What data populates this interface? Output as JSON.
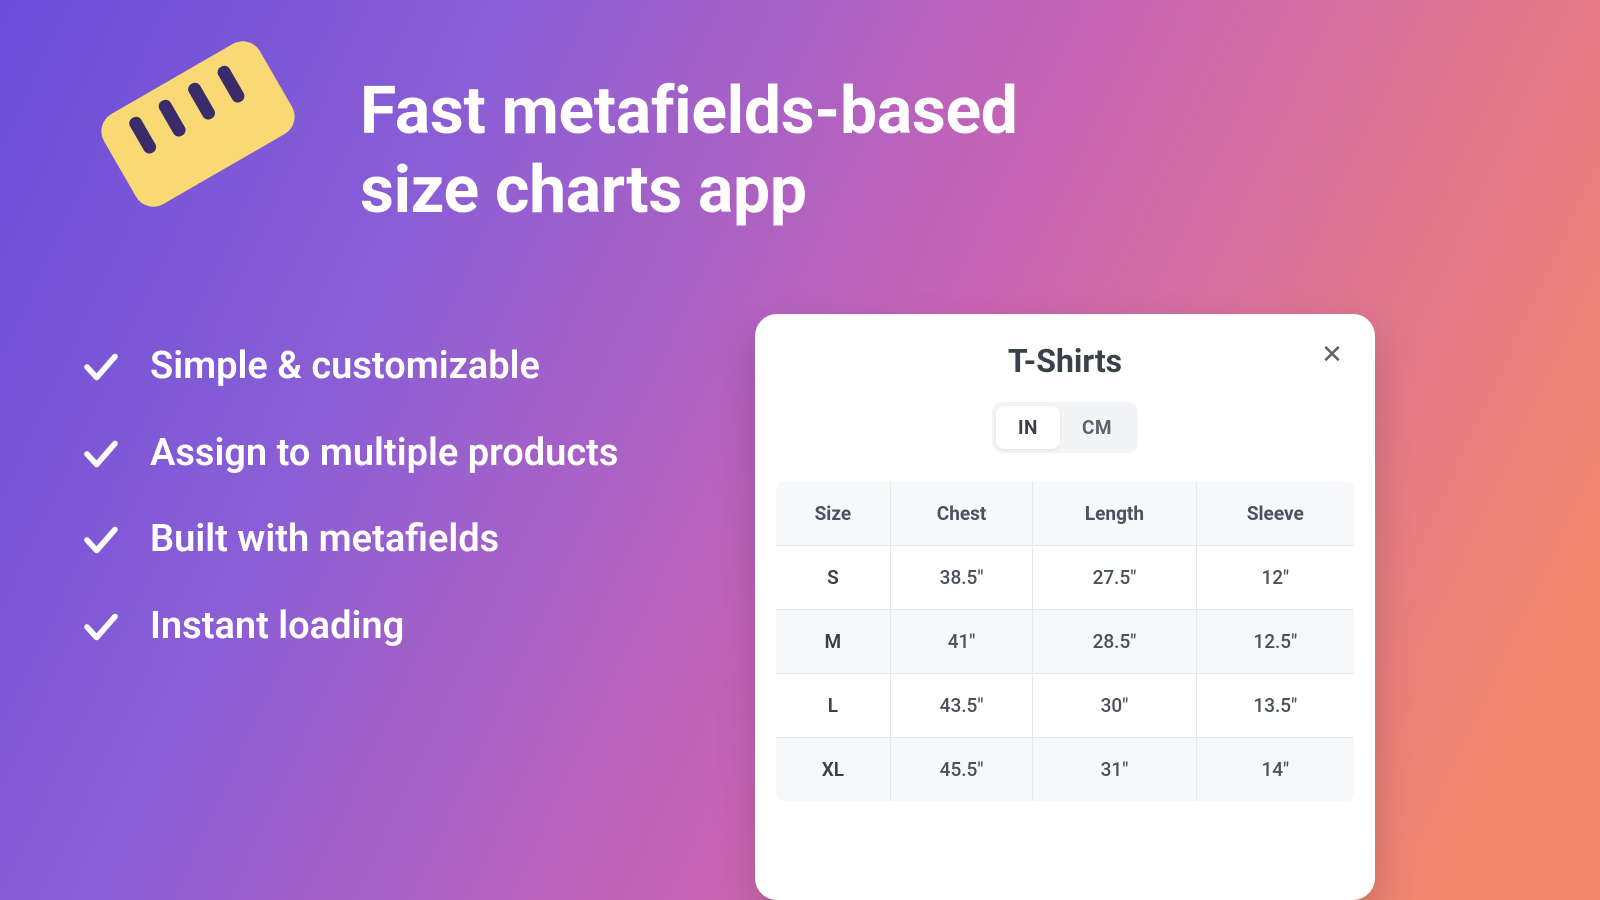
{
  "headline_line1": "Fast metafields-based",
  "headline_line2": "size charts app",
  "features": {
    "f0": "Simple & customizable",
    "f1": "Assign to multiple products",
    "f2": "Built with metafields",
    "f3": "Instant loading"
  },
  "card": {
    "title": "T-Shirts",
    "unit_in": "IN",
    "unit_cm": "CM",
    "columns": {
      "c0": "Size",
      "c1": "Chest",
      "c2": "Length",
      "c3": "Sleeve"
    },
    "rows": {
      "r0": {
        "size": "S",
        "chest": "38.5\"",
        "length": "27.5\"",
        "sleeve": "12\""
      },
      "r1": {
        "size": "M",
        "chest": "41\"",
        "length": "28.5\"",
        "sleeve": "12.5\""
      },
      "r2": {
        "size": "L",
        "chest": "43.5\"",
        "length": "30\"",
        "sleeve": "13.5\""
      },
      "r3": {
        "size": "XL",
        "chest": "45.5\"",
        "length": "31\"",
        "sleeve": "14\""
      }
    }
  }
}
